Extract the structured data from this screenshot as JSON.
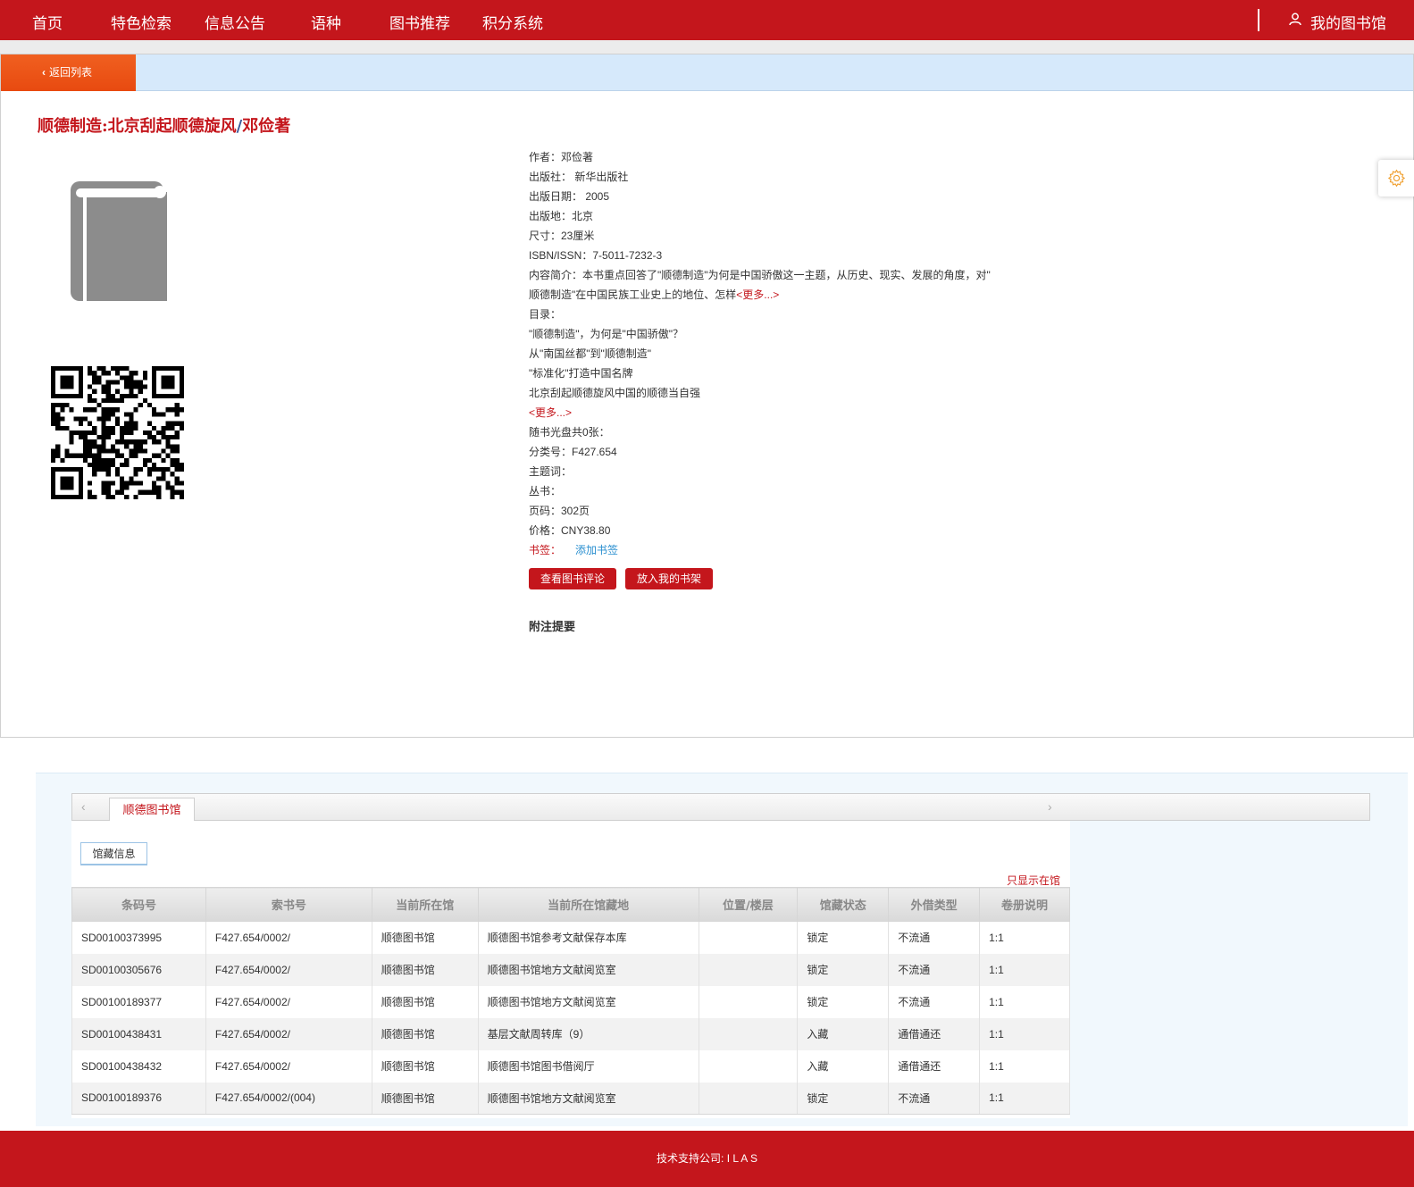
{
  "nav": {
    "items": [
      "首页",
      "特色检索",
      "信息公告",
      "语种",
      "图书推荐",
      "积分系统"
    ],
    "my_library": "我的图书馆"
  },
  "back_button": "返回列表",
  "book": {
    "title_main": "顺德制造:北京刮起顺德旋风",
    "title_sep": "/",
    "title_author": "邓俭著",
    "meta": [
      "作者：邓俭著",
      "出版社： 新华出版社",
      "出版日期： 2005",
      "出版地：北京",
      "尺寸：23厘米",
      "ISBN/ISSN：7-5011-7232-3",
      "内容简介：本书重点回答了\"顺德制造\"为何是中国骄傲这一主题，从历史、现实、发展的角度，对\"",
      "顺德制造\"在中国民族工业史上的地位、怎样",
      "目录：",
      "\"顺德制造\"，为何是\"中国骄傲\"？",
      "从\"南国丝都\"到\"顺德制造\"",
      "\"标准化\"打造中国名牌",
      "北京刮起顺德旋风中国的顺德当自强",
      "",
      "随书光盘共0张：",
      "分类号：F427.654",
      "主题词：",
      "丛书：",
      "页码：302页",
      "价格：CNY38.80"
    ],
    "more_label": "<更多...>",
    "bookmark_label": "书签：",
    "bookmark_add": "添加书签",
    "btn_reviews": "查看图书评论",
    "btn_shelf": "放入我的书架",
    "notes_heading": "附注提要"
  },
  "holdings": {
    "library_tab": "顺德图书馆",
    "sub_tab": "馆藏信息",
    "only_show": "只显示在馆",
    "columns": [
      "条码号",
      "索书号",
      "当前所在馆",
      "当前所在馆藏地",
      "位置/楼层",
      "馆藏状态",
      "外借类型",
      "卷册说明"
    ],
    "rows": [
      [
        "SD00100373995",
        "F427.654/0002/",
        "顺德图书馆",
        "顺德图书馆参考文献保存本库",
        "",
        "锁定",
        "不流通",
        "1:1"
      ],
      [
        "SD00100305676",
        "F427.654/0002/",
        "顺德图书馆",
        "顺德图书馆地方文献阅览室",
        "",
        "锁定",
        "不流通",
        "1:1"
      ],
      [
        "SD00100189377",
        "F427.654/0002/",
        "顺德图书馆",
        "顺德图书馆地方文献阅览室",
        "",
        "锁定",
        "不流通",
        "1:1"
      ],
      [
        "SD00100438431",
        "F427.654/0002/",
        "顺德图书馆",
        "基层文献周转库（9）",
        "",
        "入藏",
        "通借通还",
        "1:1"
      ],
      [
        "SD00100438432",
        "F427.654/0002/",
        "顺德图书馆",
        "顺德图书馆图书借阅厅",
        "",
        "入藏",
        "通借通还",
        "1:1"
      ],
      [
        "SD00100189376",
        "F427.654/0002/(004)",
        "顺德图书馆",
        "顺德图书馆地方文献阅览室",
        "",
        "锁定",
        "不流通",
        "1:1"
      ]
    ]
  },
  "footer": "技术支持公司: I L A S",
  "colors": {
    "brand_red": "#c4161c",
    "back_orange": "#f06020",
    "link_blue": "#2a8fd0",
    "info_bar": "#d6e9fb"
  },
  "icons": [
    "user-icon",
    "chevron-left-icon",
    "book-icon",
    "qr-code",
    "gear-icon",
    "arrow-left-icon",
    "arrow-right-icon"
  ]
}
